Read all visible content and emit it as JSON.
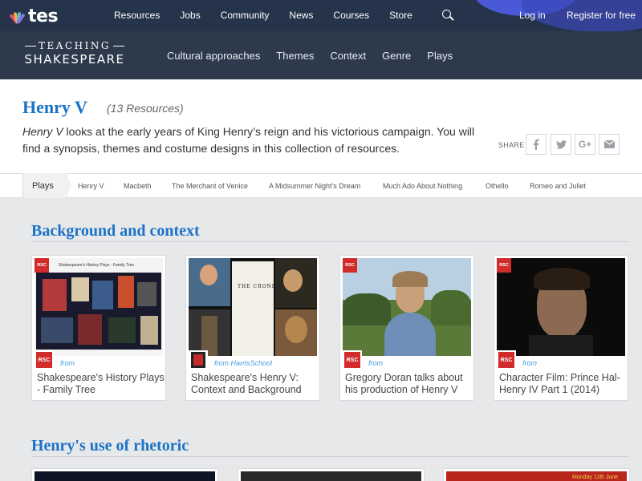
{
  "topbar": {
    "brand": "tes",
    "nav": [
      "Resources",
      "Jobs",
      "Community",
      "News",
      "Courses",
      "Store"
    ],
    "login": "Log in",
    "register": "Register for free"
  },
  "ts_logo": {
    "line1": "TEACHING",
    "line2": "SHAKESPEARE"
  },
  "subnav": [
    "Cultural approaches",
    "Themes",
    "Context",
    "Genre",
    "Plays"
  ],
  "page": {
    "title": "Henry V",
    "resource_count": "(13 Resources)",
    "desc_em": "Henry V",
    "desc_rest": " looks at the early years of King Henry’s reign and his victorious campaign. You will find a synopsis, themes and costume designs in this collection of resources.",
    "share_label": "SHARE"
  },
  "plays_bar": {
    "tab": "Plays",
    "items": [
      "Henry V",
      "Macbeth",
      "The Merchant of Venice",
      "A Midsummer Night's Dream",
      "Much Ado About Nothing",
      "Othello",
      "Romeo and Juliet"
    ]
  },
  "sections": [
    {
      "title": "Background and context",
      "cards": [
        {
          "publisher": "RSC",
          "from": "from",
          "title": "Shakespeare's History Plays - Family Tree",
          "thumb_caption": "Shakespeare's History Plays - Family Tree"
        },
        {
          "publisher": "HarrisSchool",
          "from": "from HarrisSchool",
          "title": "Shakespeare's Henry V: Context and Background",
          "thumb_caption": "THE CRONICLE"
        },
        {
          "publisher": "RSC",
          "from": "from",
          "title": "Gregory Doran talks about his production of Henry V"
        },
        {
          "publisher": "RSC",
          "from": "from",
          "title": "Character Film: Prince Hal- Henry IV Part 1 (2014)"
        }
      ]
    },
    {
      "title": "Henry's use of rhetoric",
      "teaser": "Monday 11th June"
    }
  ],
  "colors": {
    "accent": "#1b73c6",
    "topbar": "#25344a",
    "rsc_red": "#d12b2b"
  }
}
